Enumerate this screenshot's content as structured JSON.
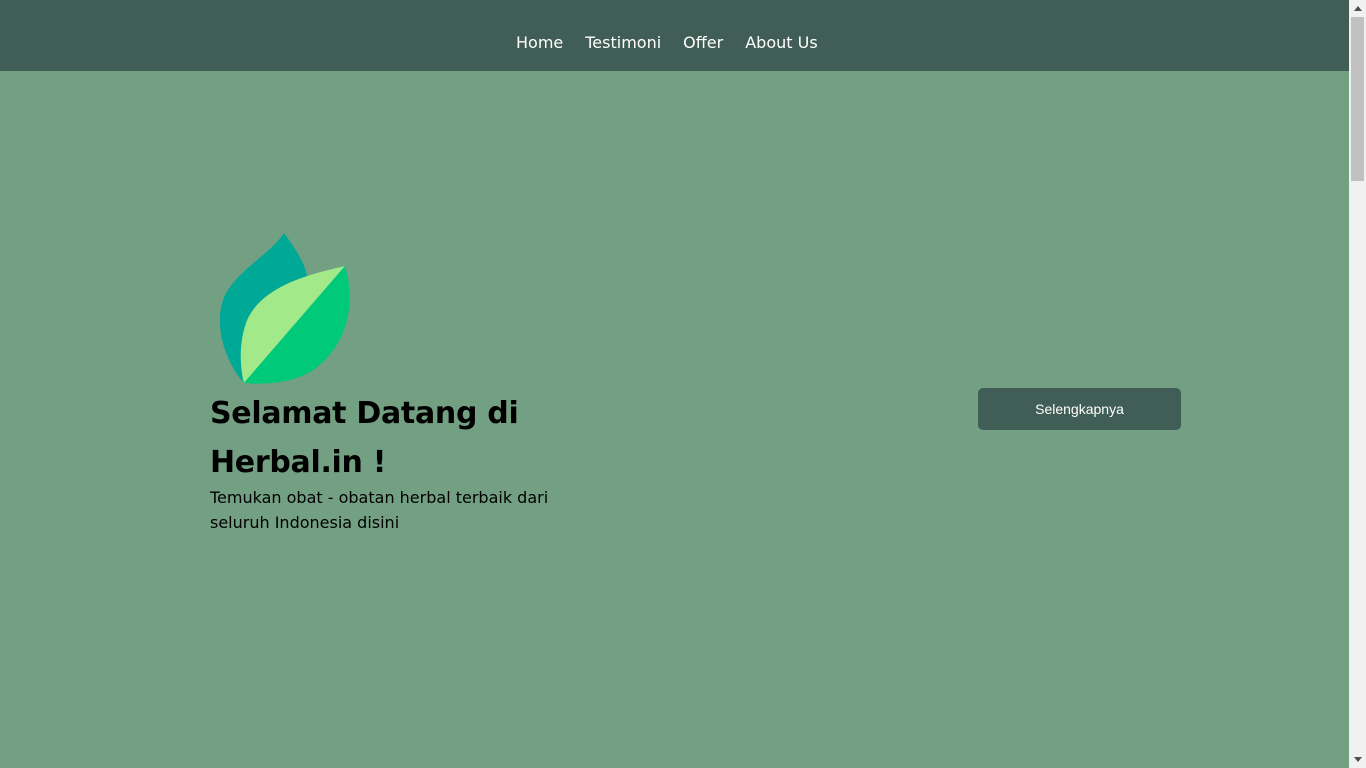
{
  "nav": {
    "items": [
      {
        "label": "Home"
      },
      {
        "label": "Testimoni"
      },
      {
        "label": "Offer"
      },
      {
        "label": "About Us"
      }
    ]
  },
  "hero": {
    "logo_icon": "leaf-icon",
    "title": "Selamat Datang di Herbal.in !",
    "subtitle": "Temukan obat - obatan herbal terbaik dari seluruh Indonesia disini",
    "cta_label": "Selengkapnya"
  },
  "colors": {
    "navbar_bg": "#415e56",
    "page_bg": "#73a083",
    "button_bg": "#415e56",
    "leaf_back": "#00a896",
    "leaf_front_light": "#a2e98a",
    "leaf_front_dark": "#00c97a"
  }
}
